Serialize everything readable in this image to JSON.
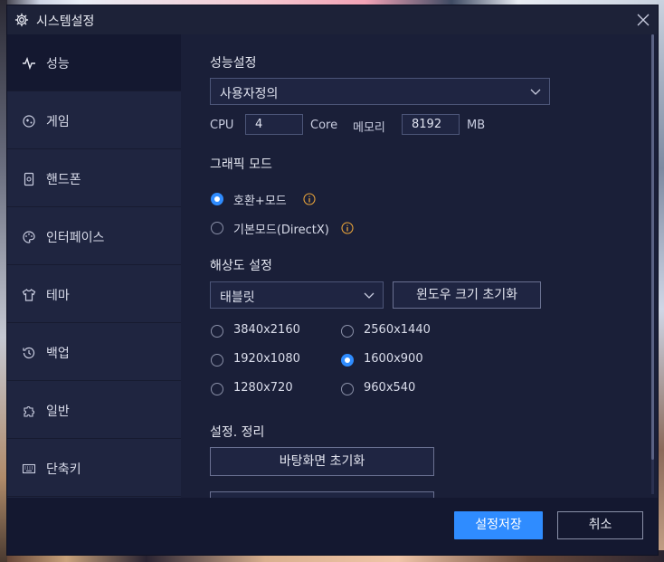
{
  "window": {
    "title": "시스템설정"
  },
  "sidebar": {
    "items": [
      {
        "label": "성능",
        "icon": "activity-icon",
        "active": true
      },
      {
        "label": "게임",
        "icon": "gamepad-icon"
      },
      {
        "label": "핸드폰",
        "icon": "phone-icon"
      },
      {
        "label": "인터페이스",
        "icon": "palette-icon"
      },
      {
        "label": "테마",
        "icon": "shirt-icon"
      },
      {
        "label": "백업",
        "icon": "history-icon"
      },
      {
        "label": "일반",
        "icon": "puzzle-icon"
      },
      {
        "label": "단축키",
        "icon": "keyboard-icon"
      }
    ]
  },
  "performance": {
    "title": "성능설정",
    "preset": "사용자정의",
    "cpu_label": "CPU",
    "cpu_value": "4",
    "core_label": "Core",
    "memory_label": "메모리",
    "memory_value": "8192",
    "mb_label": "MB"
  },
  "graphics": {
    "title": "그래픽 모드",
    "options": [
      {
        "label": "호환+모드",
        "selected": true
      },
      {
        "label": "기본모드(DirectX)",
        "selected": false
      }
    ]
  },
  "resolution": {
    "title": "해상도 설정",
    "device": "태블릿",
    "reset_window_label": "윈도우 크기 초기화",
    "options": [
      {
        "label": "3840x2160",
        "selected": false
      },
      {
        "label": "2560x1440",
        "selected": false
      },
      {
        "label": "1920x1080",
        "selected": false
      },
      {
        "label": "1600x900",
        "selected": true
      },
      {
        "label": "1280x720",
        "selected": false
      },
      {
        "label": "960x540",
        "selected": false
      }
    ]
  },
  "cleanup": {
    "title": "설정. 정리",
    "reset_desktop_label": "바탕화면 초기화"
  },
  "footer": {
    "save_label": "설정저장",
    "cancel_label": "취소"
  },
  "colors": {
    "accent": "#2f8cff",
    "dialog_bg": "#1a1f38",
    "sidebar_bg": "#1f2540",
    "info_icon": "#e8a33a"
  }
}
